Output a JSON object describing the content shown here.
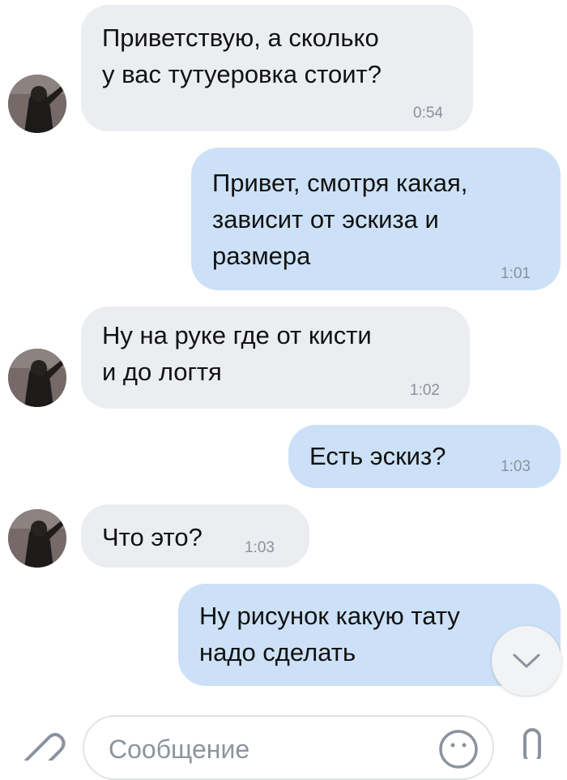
{
  "messages": [
    {
      "direction": "incoming",
      "text": "Приветствую, а сколько\nу вас тутуеровка стоит?",
      "time": "0:54"
    },
    {
      "direction": "outgoing",
      "text": "Привет, смотря какая,\nзависит от эскиза и\nразмера",
      "time": "1:01"
    },
    {
      "direction": "incoming",
      "text": "Ну на руке где от кисти\nи до логтя",
      "time": "1:02"
    },
    {
      "direction": "outgoing",
      "text": "Есть эскиз?",
      "time": "1:03"
    },
    {
      "direction": "incoming",
      "text": "Что это?",
      "time": "1:03"
    },
    {
      "direction": "outgoing",
      "text": "Ну рисунок какую тату\nнадо сделать",
      "time": ""
    }
  ],
  "composer": {
    "placeholder": "Сообщение",
    "attach_icon": "paperclip-icon",
    "emoji_icon": "smile-icon",
    "voice_icon": "microphone-icon"
  },
  "scroll_down_icon": "chevron-down-icon",
  "colors": {
    "incoming_bubble": "#ebedf0",
    "outgoing_bubble": "#cce1f7",
    "time_text": "#8a929c"
  }
}
